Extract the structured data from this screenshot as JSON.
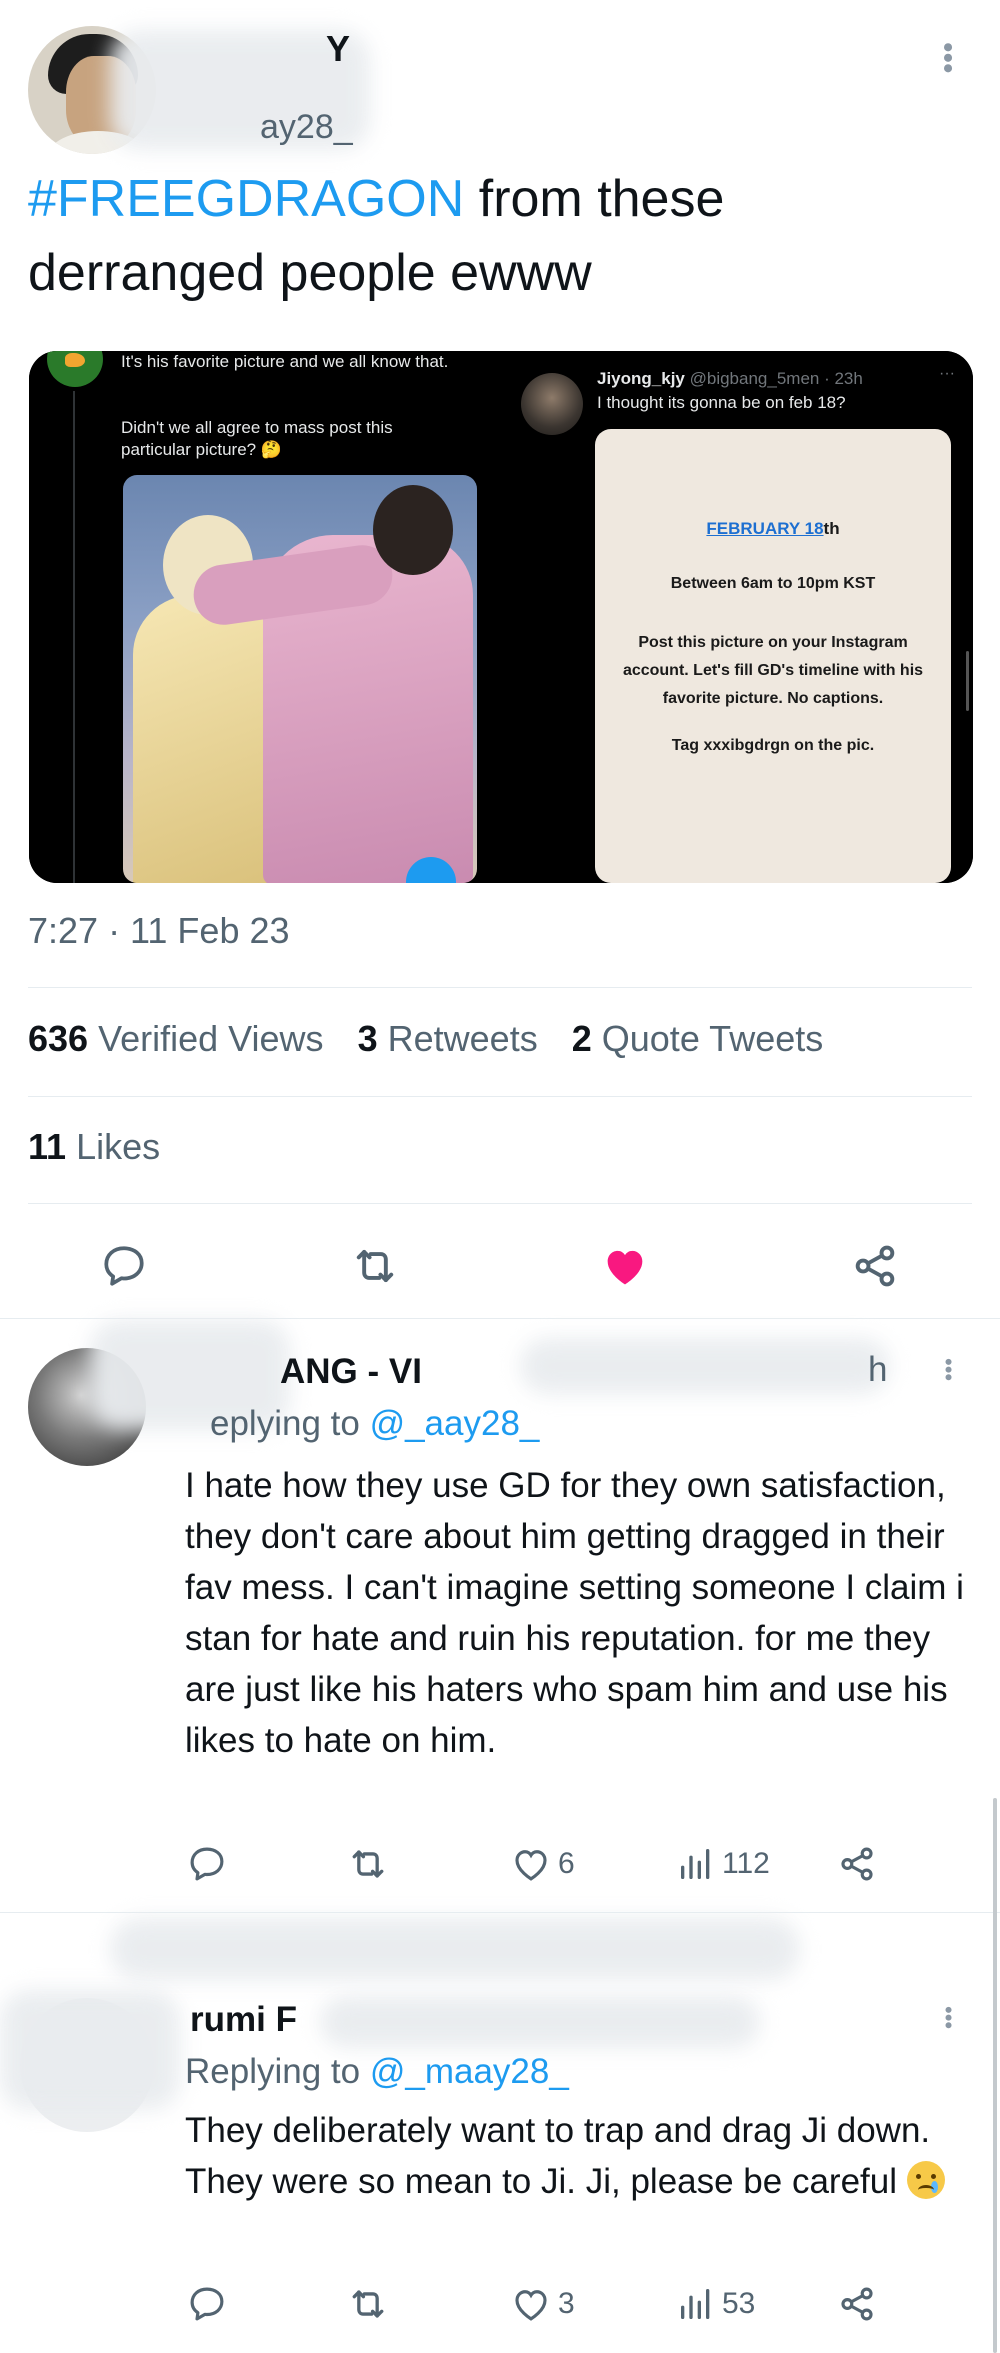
{
  "main_tweet": {
    "author_name": "Y",
    "author_handle": "ay28_",
    "hashtag": "#FREEGDRAGON",
    "text_rest": " from these derranged people ewww",
    "timestamp": "7:27 · 11 Feb 23",
    "stats": {
      "views_count": "636",
      "views_label": "Verified Views",
      "retweets_count": "3",
      "retweets_label": "Retweets",
      "quotes_count": "2",
      "quotes_label": "Quote Tweets",
      "likes_count": "11",
      "likes_label": "Likes"
    },
    "media": {
      "left": {
        "line1": "It's his favorite picture and we all know that.",
        "line2": "Didn't we all agree to mass post this particular picture? 🤔"
      },
      "right": {
        "name": "Jiyong_kjy",
        "handle_time": "@bigbang_5men · 23h",
        "more": "···",
        "reply_text": "I thought its gonna be on feb 18?",
        "card_date_underlined": "FEBRUARY 18",
        "card_date_suffix": "th",
        "card_line1": "Between 6am to 10pm KST",
        "card_line2": "Post this picture on your Instagram account. Let's fill GD's timeline with his favorite picture. No captions.",
        "card_line3": "Tag xxxibgdrgn on the pic."
      }
    }
  },
  "replies": [
    {
      "name": "ANG - VI",
      "time": "h",
      "replying_label": "eplying to",
      "replying_handle": "@_aay28_",
      "text": "I hate how they use GD for they own satisfaction, they don't care about him getting dragged in their fav mess. I can't imagine setting someone I claim i stan for hate and ruin his reputation.  for me they are just like his haters who spam him and use his likes to hate on him.",
      "likes": "6",
      "views": "112"
    },
    {
      "name": "rumi F",
      "replying_label": "Replying to",
      "replying_handle": "@_maay28_",
      "text": "They deliberately want to trap and drag Ji down. They were so mean to Ji. Ji, please be careful",
      "likes": "3",
      "views": "53"
    }
  ],
  "icons": {
    "reply": "reply-bubble-icon",
    "retweet": "retweet-icon",
    "like": "heart-icon",
    "share": "share-icon",
    "views": "views-bar-icon",
    "more": "more-dots-icon"
  },
  "colors": {
    "accent": "#1d9bf0",
    "like_active": "#f91880",
    "secondary_text": "#536471"
  }
}
